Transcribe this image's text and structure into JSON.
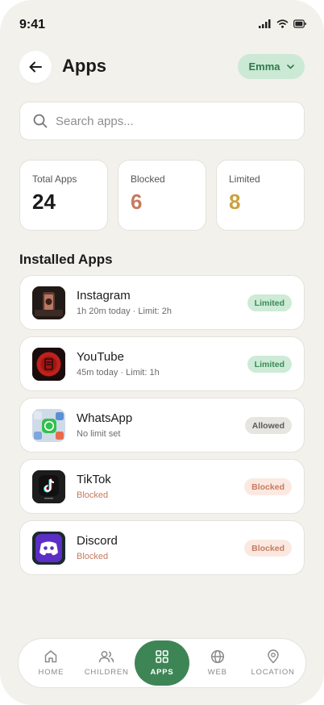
{
  "status_bar": {
    "time": "9:41"
  },
  "header": {
    "title": "Apps",
    "child_name": "Emma"
  },
  "search": {
    "placeholder": "Search apps..."
  },
  "stats": [
    {
      "label": "Total Apps",
      "value": "24",
      "color": "#1b1b1b"
    },
    {
      "label": "Blocked",
      "value": "6",
      "color": "#c77a5f"
    },
    {
      "label": "Limited",
      "value": "8",
      "color": "#c9a23f"
    }
  ],
  "section_title": "Installed Apps",
  "apps": [
    {
      "name": "Instagram",
      "detail": "1h 20m today · Limit: 2h",
      "status": "Limited",
      "icon": "instagram-icon"
    },
    {
      "name": "YouTube",
      "detail": "45m today · Limit: 1h",
      "status": "Limited",
      "icon": "youtube-icon"
    },
    {
      "name": "WhatsApp",
      "detail": "No limit set",
      "status": "Allowed",
      "icon": "whatsapp-icon"
    },
    {
      "name": "TikTok",
      "detail": "Blocked",
      "status": "Blocked",
      "icon": "tiktok-icon"
    },
    {
      "name": "Discord",
      "detail": "Blocked",
      "status": "Blocked",
      "icon": "discord-icon"
    }
  ],
  "nav": [
    {
      "label": "HOME",
      "icon": "home-icon",
      "active": false
    },
    {
      "label": "CHILDREN",
      "icon": "users-icon",
      "active": false
    },
    {
      "label": "APPS",
      "icon": "grid-icon",
      "active": true
    },
    {
      "label": "WEB",
      "icon": "globe-icon",
      "active": false
    },
    {
      "label": "LOCATION",
      "icon": "map-pin-icon",
      "active": false
    }
  ],
  "colors": {
    "accent": "#3e8555",
    "background": "#f2f1ec",
    "limited": "#3b8a57",
    "blocked": "#c77a5f"
  }
}
